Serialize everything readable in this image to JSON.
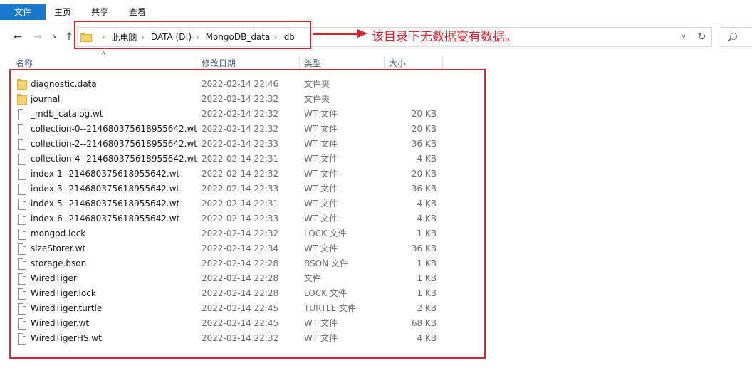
{
  "ribbon": {
    "tabs": [
      "文件",
      "主页",
      "共享",
      "查看"
    ]
  },
  "address": {
    "crumbs": [
      "此电脑",
      "DATA (D:)",
      "MongoDB_data",
      "db"
    ]
  },
  "annotation": {
    "text": "该目录下无数据变有数据。",
    "color": "#e0242f"
  },
  "columns": {
    "name": "名称",
    "date": "修改日期",
    "type": "类型",
    "size": "大小"
  },
  "files": [
    {
      "name": "diagnostic.data",
      "date": "2022-02-14 22:46",
      "type": "文件夹",
      "size": "",
      "icon": "folder-icon"
    },
    {
      "name": "journal",
      "date": "2022-02-14 22:32",
      "type": "文件夹",
      "size": "",
      "icon": "folder-icon"
    },
    {
      "name": "_mdb_catalog.wt",
      "date": "2022-02-14 22:32",
      "type": "WT 文件",
      "size": "20 KB",
      "icon": "file-icon"
    },
    {
      "name": "collection-0--214680375618955642.wt",
      "date": "2022-02-14 22:32",
      "type": "WT 文件",
      "size": "20 KB",
      "icon": "file-icon"
    },
    {
      "name": "collection-2--214680375618955642.wt",
      "date": "2022-02-14 22:33",
      "type": "WT 文件",
      "size": "36 KB",
      "icon": "file-icon"
    },
    {
      "name": "collection-4--214680375618955642.wt",
      "date": "2022-02-14 22:31",
      "type": "WT 文件",
      "size": "4 KB",
      "icon": "file-icon"
    },
    {
      "name": "index-1--214680375618955642.wt",
      "date": "2022-02-14 22:32",
      "type": "WT 文件",
      "size": "20 KB",
      "icon": "file-icon"
    },
    {
      "name": "index-3--214680375618955642.wt",
      "date": "2022-02-14 22:33",
      "type": "WT 文件",
      "size": "36 KB",
      "icon": "file-icon"
    },
    {
      "name": "index-5--214680375618955642.wt",
      "date": "2022-02-14 22:31",
      "type": "WT 文件",
      "size": "4 KB",
      "icon": "file-icon"
    },
    {
      "name": "index-6--214680375618955642.wt",
      "date": "2022-02-14 22:33",
      "type": "WT 文件",
      "size": "4 KB",
      "icon": "file-icon"
    },
    {
      "name": "mongod.lock",
      "date": "2022-02-14 22:32",
      "type": "LOCK 文件",
      "size": "1 KB",
      "icon": "file-icon"
    },
    {
      "name": "sizeStorer.wt",
      "date": "2022-02-14 22:34",
      "type": "WT 文件",
      "size": "36 KB",
      "icon": "file-icon"
    },
    {
      "name": "storage.bson",
      "date": "2022-02-14 22:28",
      "type": "BSON 文件",
      "size": "1 KB",
      "icon": "file-icon"
    },
    {
      "name": "WiredTiger",
      "date": "2022-02-14 22:28",
      "type": "文件",
      "size": "1 KB",
      "icon": "file-icon"
    },
    {
      "name": "WiredTiger.lock",
      "date": "2022-02-14 22:28",
      "type": "LOCK 文件",
      "size": "1 KB",
      "icon": "file-icon"
    },
    {
      "name": "WiredTiger.turtle",
      "date": "2022-02-14 22:45",
      "type": "TURTLE 文件",
      "size": "2 KB",
      "icon": "file-icon"
    },
    {
      "name": "WiredTiger.wt",
      "date": "2022-02-14 22:45",
      "type": "WT 文件",
      "size": "68 KB",
      "icon": "file-icon"
    },
    {
      "name": "WiredTigerHS.wt",
      "date": "2022-02-14 22:32",
      "type": "WT 文件",
      "size": "4 KB",
      "icon": "file-icon"
    }
  ]
}
